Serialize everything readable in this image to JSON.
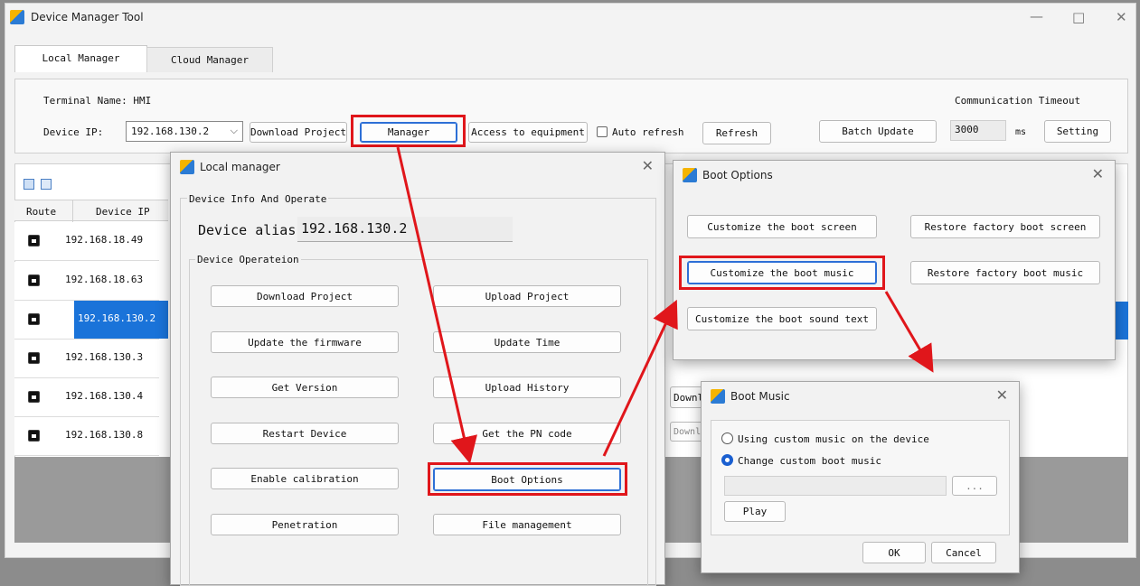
{
  "window": {
    "title": "Device Manager Tool",
    "minimize": "—",
    "maximize": "□",
    "close": "✕"
  },
  "tabs": [
    {
      "label": "Local Manager",
      "active": true
    },
    {
      "label": "Cloud Manager",
      "active": false
    }
  ],
  "top_panel": {
    "terminal_name": "Terminal Name: HMI",
    "device_ip_label": "Device IP:",
    "device_ip_value": "192.168.130.2",
    "download_project": "Download Project",
    "manager": "Manager",
    "access_equipment": "Access to equipment",
    "auto_refresh": "Auto refresh",
    "refresh": "Refresh",
    "batch_update": "Batch Update",
    "comm_timeout_label": "Communication Timeout",
    "timeout_value": "3000",
    "timeout_unit": "ms",
    "setting": "Setting"
  },
  "device_table": {
    "headers": [
      "Route",
      "Device IP"
    ],
    "rows": [
      {
        "ip": "192.168.18.49",
        "selected": false
      },
      {
        "ip": "192.168.18.63",
        "selected": false
      },
      {
        "ip": "192.168.130.2",
        "selected": true
      },
      {
        "ip": "192.168.130.3",
        "selected": false
      },
      {
        "ip": "192.168.130.4",
        "selected": false
      },
      {
        "ip": "192.168.130.8",
        "selected": false
      }
    ],
    "partial_download_1": "Downl",
    "partial_download_2": "Downl"
  },
  "local_manager": {
    "title": "Local manager",
    "close": "✕",
    "group_info": "Device Info And Operate",
    "alias_label": "Device alias",
    "alias_value": "192.168.130.2",
    "group_operation": "Device Operateion",
    "buttons": {
      "download_project": "Download Project",
      "upload_project": "Upload Project",
      "update_firmware": "Update the firmware",
      "update_time": "Update Time",
      "get_version": "Get Version",
      "upload_history": "Upload History",
      "restart_device": "Restart Device",
      "get_pn": "Get the PN code",
      "enable_calibration": "Enable calibration",
      "boot_options": "Boot Options",
      "penetration": "Penetration",
      "file_management": "File management"
    }
  },
  "boot_options": {
    "title": "Boot Options",
    "close": "✕",
    "customize_screen": "Customize the boot screen",
    "restore_screen": "Restore factory boot screen",
    "customize_music": "Customize the boot music",
    "restore_music": "Restore factory boot music",
    "customize_sound_text": "Customize the boot sound text"
  },
  "boot_music": {
    "title": "Boot Music",
    "close": "✕",
    "option1": "Using custom music on the device",
    "option2": "Change custom boot music",
    "selected_option": 2,
    "path_value": "",
    "browse": "...",
    "play": "Play",
    "ok": "OK",
    "cancel": "Cancel"
  },
  "colors": {
    "highlight_red": "#e0161b",
    "selection_blue": "#1a73d9",
    "focus_blue": "#2d6fd6"
  }
}
